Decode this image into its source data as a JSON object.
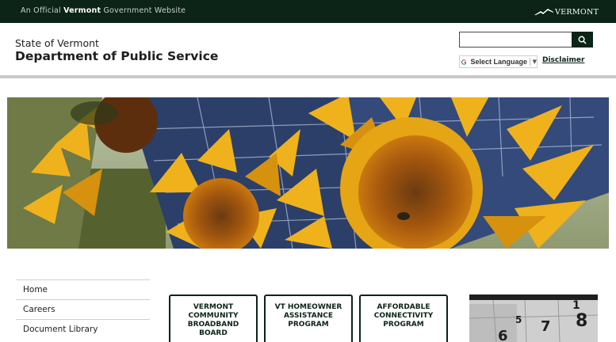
{
  "topbar": {
    "official_prefix": "An Official",
    "official_state": "Vermont",
    "official_suffix": "Government Website",
    "logo_text": "VERMONT"
  },
  "header": {
    "state": "State of Vermont",
    "department": "Department of Public Service"
  },
  "search": {
    "value": "",
    "placeholder": "",
    "button_icon": "search-icon"
  },
  "translate": {
    "label": "Select Language",
    "arrow": "▼",
    "icon": "google-g-icon"
  },
  "disclaimer_label": "Disclaimer",
  "hero_image": "solar-panels-sunflowers",
  "nav": {
    "items": [
      {
        "label": "Home"
      },
      {
        "label": "Careers"
      },
      {
        "label": "Document Library"
      }
    ]
  },
  "cards": [
    {
      "label": "Vermont Community Broadband Board"
    },
    {
      "label": "VT Homeowner Assistance Program"
    },
    {
      "label": "Affordable Connectivity Program"
    }
  ],
  "side_image": "calendar-photo",
  "calendar_digits": [
    "1",
    "5",
    "6",
    "7",
    "8"
  ],
  "colors": {
    "brand_dark": "#0c2317",
    "rule_gray": "#c8c8c8"
  }
}
